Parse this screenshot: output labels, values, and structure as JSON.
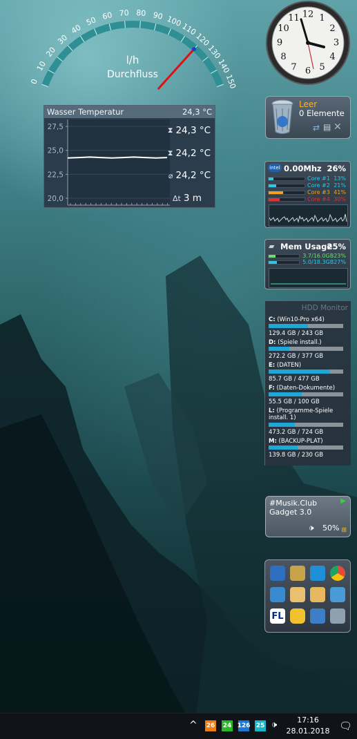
{
  "gauge": {
    "ticks": [
      "0",
      "10",
      "20",
      "30",
      "40",
      "50",
      "60",
      "70",
      "80",
      "90",
      "100",
      "110",
      "120",
      "130",
      "140",
      "150"
    ],
    "unit": "l/h",
    "label": "Durchfluss",
    "value": 120
  },
  "clock": {
    "numerals": [
      "12",
      "1",
      "2",
      "3",
      "4",
      "5",
      "6",
      "7",
      "8",
      "9",
      "10",
      "11"
    ]
  },
  "water_temp": {
    "title": "Wasser Temperatur",
    "current": "24,3 °C",
    "y_ticks": [
      "27,5",
      "25,0",
      "22,5",
      "20,0"
    ],
    "max_label": "24,3 °C",
    "min_label": "24,2 °C",
    "avg_label": "24,2 °C",
    "period_label": "3 m",
    "chart_data": {
      "type": "line",
      "title": "Wasser Temperatur",
      "ylim": [
        20.0,
        27.5
      ],
      "y_ticks": [
        27.5,
        25.0,
        22.5,
        20.0
      ],
      "series": [
        {
          "values": [
            24.2,
            24.25,
            24.3,
            24.25,
            24.2,
            24.25,
            24.3,
            24.25,
            24.2,
            24.25
          ]
        }
      ]
    }
  },
  "recycle_bin": {
    "title": "Leer",
    "count": "0 Elemente"
  },
  "cpu": {
    "freq": "0.00Mhz",
    "total": "26%",
    "cores": [
      {
        "label": "Core #1",
        "value": "13%",
        "pct": 13,
        "color": "#2cc6e6"
      },
      {
        "label": "Core #2",
        "value": "21%",
        "pct": 21,
        "color": "#2cc6e6"
      },
      {
        "label": "Core #3",
        "value": "41%",
        "pct": 41,
        "color": "#f0a020"
      },
      {
        "label": "Core #4",
        "value": "30%",
        "pct": 30,
        "color": "#e03030"
      }
    ]
  },
  "memory": {
    "title": "Mem Usage",
    "total": "25%",
    "rows": [
      {
        "label": "3.7/16.0GB",
        "value": "23%",
        "pct": 23,
        "color": "#6fdc6f"
      },
      {
        "label": "5.0/18.3GB",
        "value": "27%",
        "pct": 27,
        "color": "#2cc6e6"
      }
    ]
  },
  "hdd": {
    "title": "HDD Monitor",
    "drives": [
      {
        "letter": "C:",
        "name": " (Win10-Pro x64)",
        "size": "129.4 GB / 243 GB",
        "pct": 53
      },
      {
        "letter": "D:",
        "name": " (Spiele install.)",
        "size": "272.2 GB / 377 GB",
        "pct": 28
      },
      {
        "letter": "E:",
        "name": " (DATEN)",
        "size": "85.7 GB / 477 GB",
        "pct": 82
      },
      {
        "letter": "F:",
        "name": " (Daten-Dokumente)",
        "size": "55.5 GB / 100 GB",
        "pct": 44
      },
      {
        "letter": "L:",
        "name": " (Programme-Spiele install. 1)",
        "size": "473.2 GB / 724 GB",
        "pct": 35
      },
      {
        "letter": "M:",
        "name": " (BACKUP-PLAT)",
        "size": "139.8 GB / 230 GB",
        "pct": 39
      }
    ]
  },
  "music": {
    "line1": "#Musik.Club",
    "line2": "Gadget 3.0",
    "volume": "50%"
  },
  "launcher": {
    "apps": [
      {
        "icon": "mail-icon",
        "color": "#2f6fc0"
      },
      {
        "icon": "scanner-icon",
        "color": "#c9a34a"
      },
      {
        "icon": "browser-wave-icon",
        "color": "#1e8fd8"
      },
      {
        "icon": "chrome-icon",
        "color": "#e24b3b"
      },
      {
        "icon": "network-icon",
        "color": "#3a8ad0"
      },
      {
        "icon": "document-icon",
        "color": "#e8c070"
      },
      {
        "icon": "folder-doc-icon",
        "color": "#e8b860"
      },
      {
        "icon": "computer-icon",
        "color": "#4a9ad8"
      },
      {
        "icon": "fl-studio-icon",
        "color": "#ffffff",
        "text": "FL"
      },
      {
        "icon": "smiley-icon",
        "color": "#f2c12e"
      },
      {
        "icon": "monitor-icon",
        "color": "#3d7fc7"
      },
      {
        "icon": "controls-icon",
        "color": "#8fa0b0"
      }
    ]
  },
  "taskbar": {
    "badges": [
      {
        "text": "26",
        "color": "#ef7d12"
      },
      {
        "text": "24",
        "color": "#28b828"
      },
      {
        "text": "126",
        "color": "#1e78d2"
      },
      {
        "text": "25",
        "color": "#17b6c8"
      }
    ],
    "time": "17:16",
    "date": "28.01.2018"
  }
}
